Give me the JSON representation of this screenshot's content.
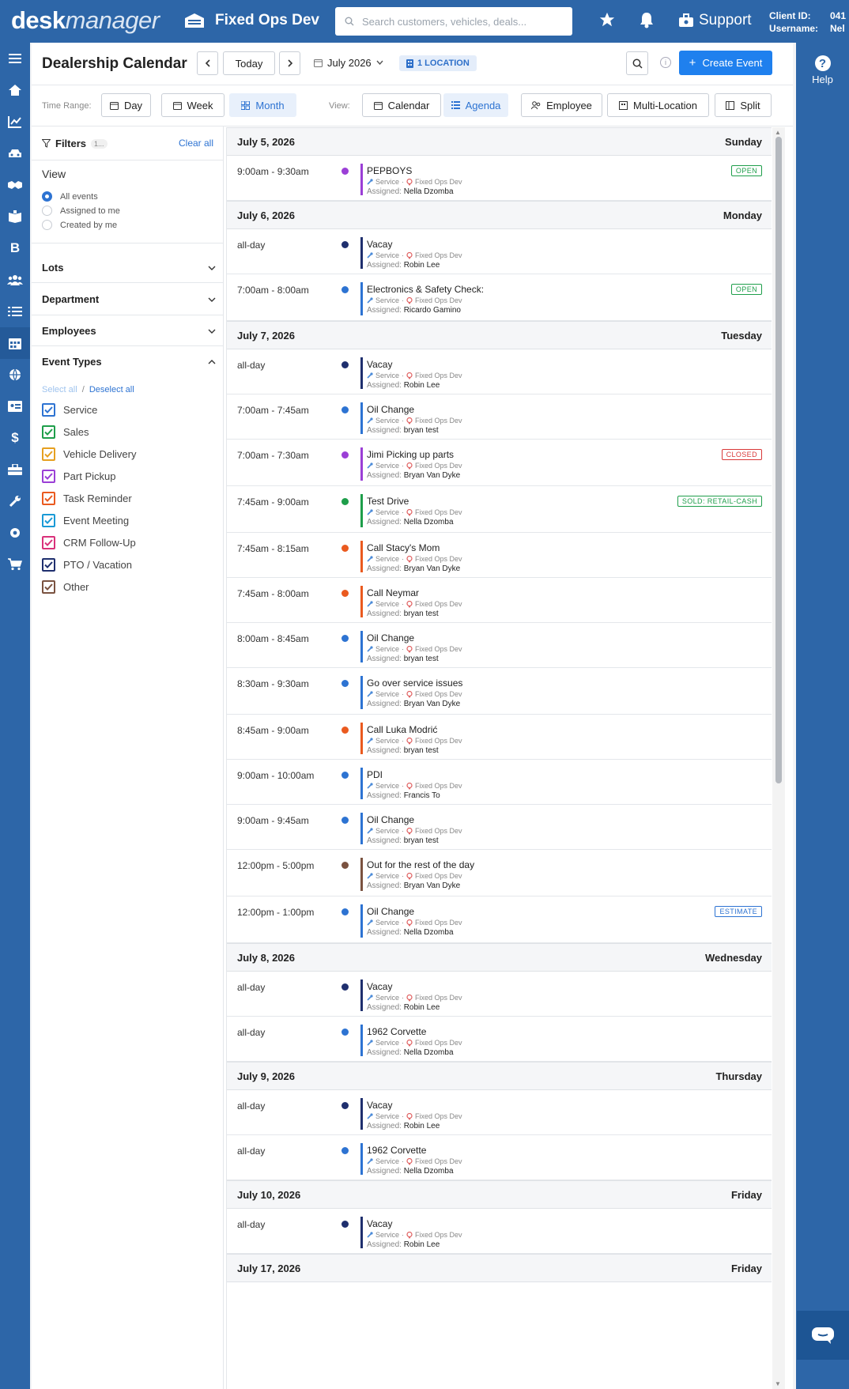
{
  "app": {
    "logo_bold": "desk",
    "logo_light": "manager",
    "dealer": "Fixed Ops Dev",
    "search_placeholder": "Search customers, vehicles, deals...",
    "support": "Support",
    "client_label": "Client ID:",
    "username_label": "Username:",
    "client_value": "041",
    "username_value": "Nel"
  },
  "help_label": "Help",
  "calendar": {
    "title": "Dealership Calendar",
    "today": "Today",
    "month": "July 2026",
    "location_badge": "1 LOCATION",
    "create": "Create Event"
  },
  "time_range": {
    "label": "Time Range:",
    "day": "Day",
    "week": "Week",
    "month": "Month"
  },
  "views": {
    "label": "View:",
    "calendar": "Calendar",
    "agenda": "Agenda",
    "employee": "Employee",
    "multi": "Multi-Location",
    "split": "Split"
  },
  "filters": {
    "title": "Filters",
    "count": "1...",
    "clear": "Clear all",
    "view_title": "View",
    "radios": [
      "All events",
      "Assigned to me",
      "Created by me"
    ],
    "lots": "Lots",
    "department": "Department",
    "employees": "Employees",
    "event_types": "Event Types",
    "select_all": "Select all",
    "separator": "/",
    "deselect_all": "Deselect all",
    "types": [
      {
        "label": "Service",
        "color": "#2d73d2"
      },
      {
        "label": "Sales",
        "color": "#1e9e4a"
      },
      {
        "label": "Vehicle Delivery",
        "color": "#e6a020"
      },
      {
        "label": "Part Pickup",
        "color": "#9b3fd6"
      },
      {
        "label": "Task Reminder",
        "color": "#ea5a1f"
      },
      {
        "label": "Event Meeting",
        "color": "#1a9ad6"
      },
      {
        "label": "CRM Follow-Up",
        "color": "#d9317a"
      },
      {
        "label": "PTO / Vacation",
        "color": "#1f2f6e"
      },
      {
        "label": "Other",
        "color": "#7a5240"
      }
    ]
  },
  "meta": {
    "dept": "Service",
    "sep": "·",
    "loc": "Fixed Ops Dev",
    "assigned": "Assigned:"
  },
  "days": [
    {
      "date": "July 5, 2026",
      "weekday": "Sunday",
      "events": [
        {
          "time": "9:00am - 9:30am",
          "title": "PEPBOYS",
          "assignee": "Nella Dzomba",
          "color": "#9b3fd6",
          "status": "OPEN",
          "status_color": "#1e9e4a"
        }
      ]
    },
    {
      "date": "July 6, 2026",
      "weekday": "Monday",
      "events": [
        {
          "time": "all-day",
          "title": "Vacay",
          "assignee": "Robin Lee",
          "color": "#1f2f6e"
        },
        {
          "time": "7:00am - 8:00am",
          "title": "Electronics & Safety Check:",
          "assignee": "Ricardo Gamino",
          "color": "#2d73d2",
          "status": "OPEN",
          "status_color": "#1e9e4a"
        }
      ]
    },
    {
      "date": "July 7, 2026",
      "weekday": "Tuesday",
      "events": [
        {
          "time": "all-day",
          "title": "Vacay",
          "assignee": "Robin Lee",
          "color": "#1f2f6e"
        },
        {
          "time": "7:00am - 7:45am",
          "title": "Oil Change",
          "assignee": "bryan test",
          "color": "#2d73d2"
        },
        {
          "time": "7:00am - 7:30am",
          "title": "Jimi Picking up parts",
          "assignee": "Bryan Van Dyke",
          "color": "#9b3fd6",
          "status": "CLOSED",
          "status_color": "#d93838"
        },
        {
          "time": "7:45am - 9:00am",
          "title": "Test Drive",
          "assignee": "Nella Dzomba",
          "color": "#1e9e4a",
          "status": "SOLD: RETAIL-CASH",
          "status_color": "#1e9e4a"
        },
        {
          "time": "7:45am - 8:15am",
          "title": "Call Stacy's Mom",
          "assignee": "Bryan Van Dyke",
          "color": "#ea5a1f"
        },
        {
          "time": "7:45am - 8:00am",
          "title": "Call Neymar",
          "assignee": "bryan test",
          "color": "#ea5a1f"
        },
        {
          "time": "8:00am - 8:45am",
          "title": "Oil Change",
          "assignee": "bryan test",
          "color": "#2d73d2"
        },
        {
          "time": "8:30am - 9:30am",
          "title": "Go over service issues",
          "assignee": "Bryan Van Dyke",
          "color": "#2d73d2"
        },
        {
          "time": "8:45am - 9:00am",
          "title": "Call Luka Modrić",
          "assignee": "bryan test",
          "color": "#ea5a1f"
        },
        {
          "time": "9:00am - 10:00am",
          "title": "PDI",
          "assignee": "Francis To",
          "color": "#2d73d2"
        },
        {
          "time": "9:00am - 9:45am",
          "title": "Oil Change",
          "assignee": "bryan test",
          "color": "#2d73d2"
        },
        {
          "time": "12:00pm - 5:00pm",
          "title": "Out for the rest of the day",
          "assignee": "Bryan Van Dyke",
          "color": "#7a5240"
        },
        {
          "time": "12:00pm - 1:00pm",
          "title": "Oil Change",
          "assignee": "Nella Dzomba",
          "color": "#2d73d2",
          "status": "ESTIMATE",
          "status_color": "#2d73d2"
        }
      ]
    },
    {
      "date": "July 8, 2026",
      "weekday": "Wednesday",
      "events": [
        {
          "time": "all-day",
          "title": "Vacay",
          "assignee": "Robin Lee",
          "color": "#1f2f6e"
        },
        {
          "time": "all-day",
          "title": "1962 Corvette",
          "assignee": "Nella Dzomba",
          "color": "#2d73d2"
        }
      ]
    },
    {
      "date": "July 9, 2026",
      "weekday": "Thursday",
      "events": [
        {
          "time": "all-day",
          "title": "Vacay",
          "assignee": "Robin Lee",
          "color": "#1f2f6e"
        },
        {
          "time": "all-day",
          "title": "1962 Corvette",
          "assignee": "Nella Dzomba",
          "color": "#2d73d2"
        }
      ]
    },
    {
      "date": "July 10, 2026",
      "weekday": "Friday",
      "events": [
        {
          "time": "all-day",
          "title": "Vacay",
          "assignee": "Robin Lee",
          "color": "#1f2f6e"
        }
      ]
    },
    {
      "date": "July 17, 2026",
      "weekday": "Friday",
      "events": []
    }
  ]
}
